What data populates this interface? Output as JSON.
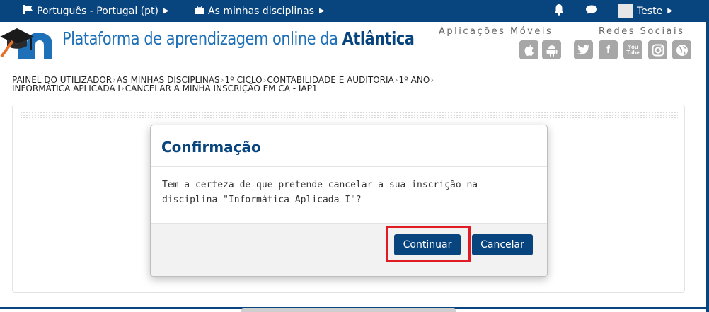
{
  "topbar": {
    "language": "Português - Portugal (pt)",
    "my_courses": "As minhas disciplinas",
    "user_name": "Teste"
  },
  "header": {
    "brand_text": "Plataforma de aprendizagem online da ",
    "brand_bold": "Atlântica",
    "apps_title": "Aplicações Móveis",
    "social_title": "Redes Sociais"
  },
  "breadcrumb": {
    "items": [
      "PAINEL DO UTILIZADOR",
      "AS MINHAS DISCIPLINAS",
      "1º CICLO",
      "CONTABILIDADE E AUDITORIA",
      "1º ANO",
      "INFORMÁTICA APLICADA I",
      "CANCELAR A MINHA INSCRIÇÃO EM CA - IAP1"
    ]
  },
  "dialog": {
    "title": "Confirmação",
    "message": "Tem a certeza de que pretende cancelar a sua inscrição na disciplina \"Informática Aplicada I\"?",
    "continue_label": "Continuar",
    "cancel_label": "Cancelar"
  },
  "icons": {
    "language": "flag-icon",
    "courses": "briefcase-icon",
    "notifications": "bell-icon",
    "messages": "chat-bubble-icon",
    "apple": "apple-icon",
    "android": "android-icon",
    "twitter": "twitter-icon",
    "facebook": "facebook-icon",
    "youtube": "youtube-icon",
    "instagram": "instagram-icon",
    "web": "globe-icon"
  },
  "colors": {
    "brand_dark": "#08447d",
    "brand_light": "#1e70b8",
    "highlight": "#e01b23",
    "social_icon": "#a7a7a7"
  }
}
